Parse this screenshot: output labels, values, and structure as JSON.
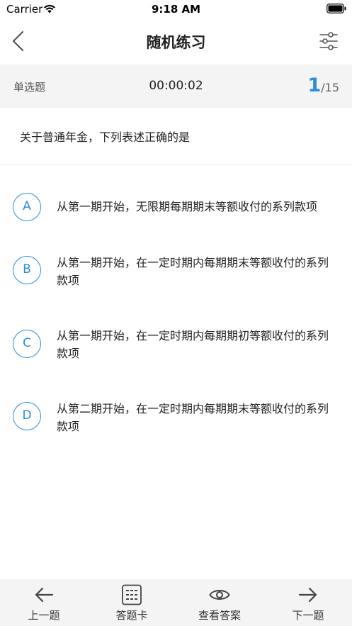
{
  "status_bar": {
    "carrier": "Carrier",
    "time": "9:18 AM"
  },
  "nav": {
    "title": "随机练习",
    "back_icon": "chevron-left-icon",
    "filter_icon": "sliders-icon"
  },
  "info": {
    "type": "单选题",
    "timer": "00:00:02",
    "current": "1",
    "total": "/15"
  },
  "question": {
    "text": "关于普通年金，下列表述正确的是"
  },
  "options": [
    {
      "letter": "A",
      "text": "从第一期开始，无限期每期期末等额收付的系列款项"
    },
    {
      "letter": "B",
      "text": "从第一期开始，在一定时期内每期期末等额收付的系列款项"
    },
    {
      "letter": "C",
      "text": "从第一期开始，在一定时期内每期期初等额收付的系列款项"
    },
    {
      "letter": "D",
      "text": "从第二期开始，在一定时期内每期期末等额收付的系列款项"
    }
  ],
  "bottom": {
    "prev": "上一题",
    "card": "答题卡",
    "answer": "查看答案",
    "next": "下一题"
  },
  "colors": {
    "accent": "#2a8cdb",
    "bar_bg": "#f4f4f4"
  }
}
